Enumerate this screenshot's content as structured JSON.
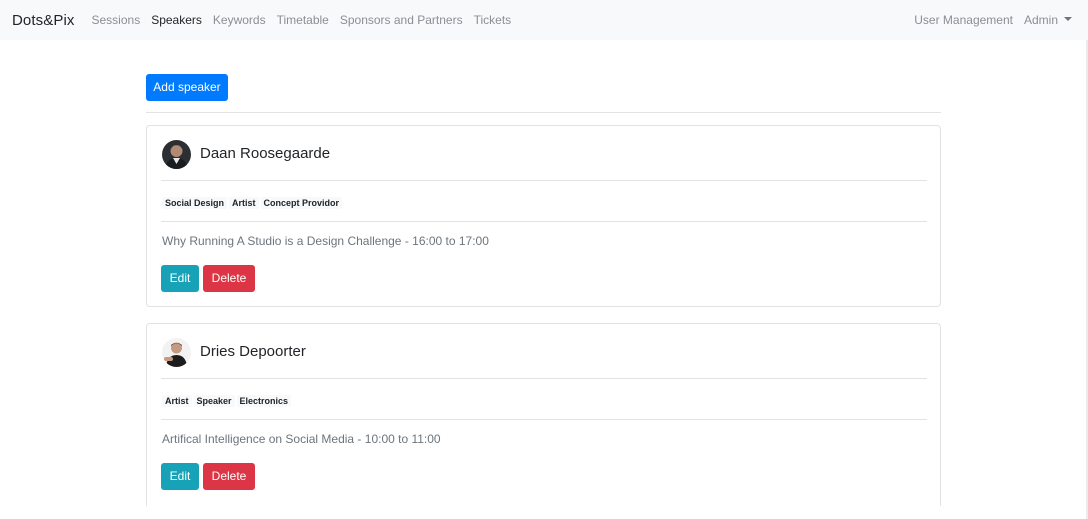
{
  "navbar": {
    "brand": "Dots&Pix",
    "links": [
      "Sessions",
      "Speakers",
      "Keywords",
      "Timetable",
      "Sponsors and Partners",
      "Tickets"
    ],
    "active": "Speakers",
    "user_management": "User Management",
    "admin": "Admin"
  },
  "page": {
    "add_speaker_label": "Add speaker"
  },
  "speakers": [
    {
      "name": "Daan Roosegaarde",
      "tags": [
        "Social Design",
        "Artist",
        "Concept Providor"
      ],
      "session": "Why Running A Studio is a Design Challenge - 16:00 to 17:00",
      "edit_label": "Edit",
      "delete_label": "Delete"
    },
    {
      "name": "Dries Depoorter",
      "tags": [
        "Artist",
        "Speaker",
        "Electronics"
      ],
      "session": "Artifical Intelligence on Social Media - 10:00 to 11:00",
      "edit_label": "Edit",
      "delete_label": "Delete"
    }
  ],
  "colors": {
    "primary": "#007bff",
    "info": "#17a2b8",
    "danger": "#dc3545",
    "navbar_bg": "#f8f9fa"
  }
}
